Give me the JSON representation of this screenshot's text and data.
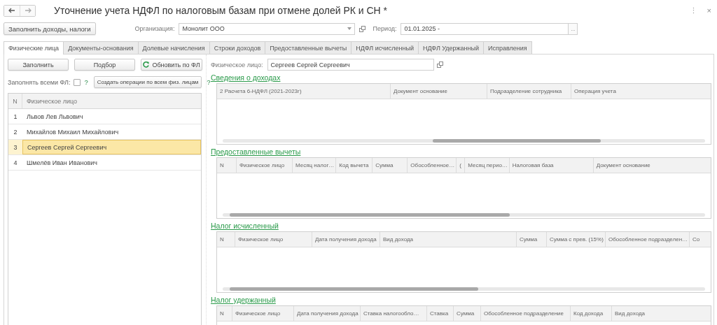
{
  "window": {
    "title": "Уточнение учета НДФЛ по налоговым базам при отмене долей РК и СН *",
    "more": "⋮",
    "close": "×"
  },
  "toolbar": {
    "fill_button": "Заполнить доходы, налоги",
    "organization": {
      "label": "Организация:",
      "value": "Монолит ООО"
    },
    "period": {
      "label": "Период:",
      "value": "01.01.2025 -",
      "select": "..."
    }
  },
  "tabs": [
    {
      "label": "Физические лица",
      "selected": true
    },
    {
      "label": "Документы-основания",
      "selected": false
    },
    {
      "label": "Долевые начисления",
      "selected": false
    },
    {
      "label": "Строки доходов",
      "selected": false
    },
    {
      "label": "Предоставленные вычеты",
      "selected": false
    },
    {
      "label": "НДФЛ исчисленный",
      "selected": false
    },
    {
      "label": "НДФЛ Удержанный",
      "selected": false
    },
    {
      "label": "Исправления",
      "selected": false
    }
  ],
  "left": {
    "buttons": [
      {
        "label": "Заполнить",
        "kind": "plain"
      },
      {
        "label": "Подбор",
        "kind": "plain"
      },
      {
        "label": "Обновить по ФЛ",
        "kind": "refresh"
      }
    ],
    "fill_all": {
      "label": "Заполнять всеми ФЛ:",
      "checked": false,
      "help": "?"
    },
    "create_button": "Создать операции по всем физ. лицам",
    "create_help": "?",
    "table": {
      "columns": [
        "N",
        "Физическое лицо"
      ],
      "rows": [
        {
          "n": "1",
          "name": "Львов Лев Львович",
          "selected": false
        },
        {
          "n": "2",
          "name": "Михайлов Михаил Михайлович",
          "selected": false
        },
        {
          "n": "3",
          "name": "Сергеев Сергей Сергеевич",
          "selected": true
        },
        {
          "n": "4",
          "name": "Шмелёв Иван Иванович",
          "selected": false
        }
      ]
    }
  },
  "person": {
    "label": "Физическое лицо:",
    "value": "Сергеев Сергей Сергеевич"
  },
  "sections": [
    {
      "title": "Сведения о доходах",
      "columns": [
        "2 Расчета 6-НДФЛ (2021-2023г)",
        "Документ основание",
        "Подразделение сотрудника",
        "Операция учета"
      ]
    },
    {
      "title": "Предоставленные вычеты",
      "columns": [
        "N",
        "Физическое лицо",
        "Месяц налог…",
        "Код вычета",
        "Сумма",
        "Обособленное…",
        "(",
        "Месяц перио…",
        "Налоговая база",
        "Документ основание"
      ]
    },
    {
      "title": "Налог исчисленный",
      "columns": [
        "N",
        "Физическое лицо",
        "Дата получения дохода",
        "Вид дохода",
        "Сумма",
        "Сумма с прев. (15%)",
        "Обособленное подразделен…",
        "Со"
      ]
    },
    {
      "title": "Налог удержанный",
      "columns": [
        "N",
        "Физическое лицо",
        "Дата получения дохода",
        "Ставка налогообло…",
        "Ставка",
        "Сумма",
        "Обособленное подразделение",
        "Код дохода",
        "Вид дохода"
      ]
    }
  ]
}
